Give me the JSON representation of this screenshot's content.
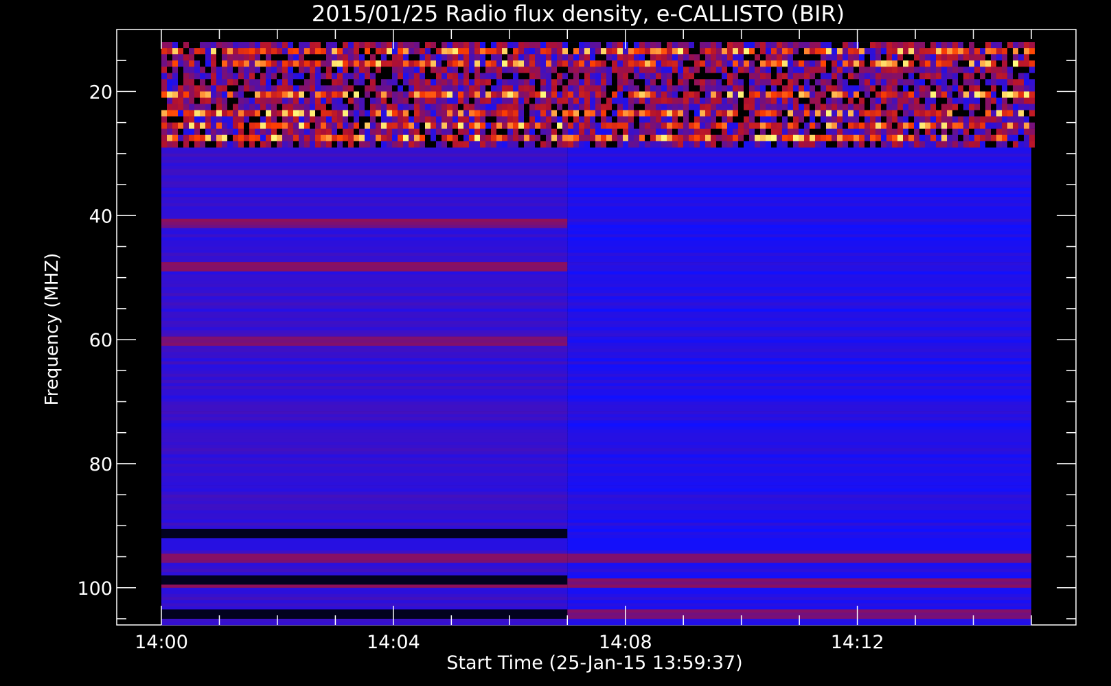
{
  "chart_data": {
    "type": "heatmap",
    "title": "2015/01/25  Radio flux density, e-CALLISTO (BIR)",
    "xlabel": "Start Time (25-Jan-15 13:59:37)",
    "ylabel": "Frequency (MHZ)",
    "x_ticks": [
      "14:00",
      "14:04",
      "14:08",
      "14:12"
    ],
    "y_ticks": [
      20,
      40,
      60,
      80,
      100
    ],
    "ylim": [
      10,
      106
    ],
    "y_inverted": true,
    "time_range": [
      "14:00",
      "14:15"
    ],
    "data_freq_range_mhz": [
      12,
      106
    ],
    "colormap": [
      "#000000",
      "#1010ff",
      "#b01030",
      "#ff4000",
      "#ffff80"
    ],
    "regime_change_time": "14:07",
    "interference_bands_mhz": [
      13,
      15,
      20,
      23,
      25,
      27
    ],
    "strong_rfi_band_mhz": 25,
    "dark_bands_left_mhz": [
      91,
      98.5,
      104
    ],
    "red_bands_mhz": [
      41,
      48,
      60,
      95,
      99,
      104
    ]
  }
}
